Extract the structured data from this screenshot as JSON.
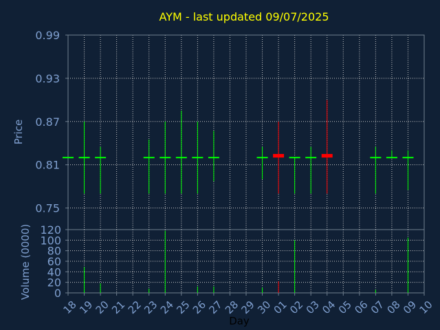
{
  "chart_data": {
    "type": "candlestick",
    "title": "AYM - last updated 09/07/2025",
    "xlabel": "Day",
    "colors": {
      "background": "#102035",
      "title": "#ffff00",
      "text": "#7f9fcf",
      "frame": "#6f7f8f",
      "grid": "#c8c8c8",
      "up": "#00ff00",
      "down": "#ff0000"
    },
    "days": [
      "18",
      "19",
      "20",
      "21",
      "22",
      "23",
      "24",
      "25",
      "26",
      "27",
      "28",
      "29",
      "30",
      "01",
      "02",
      "03",
      "04",
      "05",
      "06",
      "07",
      "08",
      "09",
      "10"
    ],
    "price_panel": {
      "ylabel": "Price",
      "ylim": [
        0.72,
        0.99
      ],
      "yticks": [
        "0.99",
        "0.93",
        "0.87",
        "0.81",
        "0.75"
      ],
      "candles": [
        {
          "day": "18",
          "open": 0.82,
          "high": 0.82,
          "low": 0.82,
          "close": 0.82,
          "dir": "up"
        },
        {
          "day": "19",
          "open": 0.82,
          "high": 0.87,
          "low": 0.77,
          "close": 0.82,
          "dir": "up"
        },
        {
          "day": "20",
          "open": 0.82,
          "high": 0.835,
          "low": 0.77,
          "close": 0.82,
          "dir": "up"
        },
        {
          "day": "23",
          "open": 0.82,
          "high": 0.845,
          "low": 0.77,
          "close": 0.82,
          "dir": "up"
        },
        {
          "day": "24",
          "open": 0.82,
          "high": 0.87,
          "low": 0.77,
          "close": 0.82,
          "dir": "up"
        },
        {
          "day": "25",
          "open": 0.82,
          "high": 0.885,
          "low": 0.77,
          "close": 0.82,
          "dir": "up"
        },
        {
          "day": "26",
          "open": 0.82,
          "high": 0.87,
          "low": 0.77,
          "close": 0.82,
          "dir": "up"
        },
        {
          "day": "27",
          "open": 0.82,
          "high": 0.857,
          "low": 0.787,
          "close": 0.82,
          "dir": "up"
        },
        {
          "day": "30",
          "open": 0.82,
          "high": 0.835,
          "low": 0.79,
          "close": 0.82,
          "dir": "up"
        },
        {
          "day": "01",
          "open": 0.825,
          "high": 0.87,
          "low": 0.77,
          "close": 0.82,
          "dir": "down"
        },
        {
          "day": "02",
          "open": 0.82,
          "high": 0.82,
          "low": 0.77,
          "close": 0.82,
          "dir": "up"
        },
        {
          "day": "03",
          "open": 0.82,
          "high": 0.835,
          "low": 0.77,
          "close": 0.82,
          "dir": "up"
        },
        {
          "day": "04",
          "open": 0.825,
          "high": 0.9,
          "low": 0.77,
          "close": 0.82,
          "dir": "down"
        },
        {
          "day": "07",
          "open": 0.82,
          "high": 0.835,
          "low": 0.77,
          "close": 0.82,
          "dir": "up"
        },
        {
          "day": "08",
          "open": 0.82,
          "high": 0.83,
          "low": 0.82,
          "close": 0.82,
          "dir": "up"
        },
        {
          "day": "09",
          "open": 0.82,
          "high": 0.83,
          "low": 0.775,
          "close": 0.82,
          "dir": "up"
        }
      ]
    },
    "volume_panel": {
      "ylabel": "Volume (0000)",
      "ylim": [
        0,
        120
      ],
      "yticks": [
        "120",
        "100",
        "80",
        "60",
        "40",
        "20",
        "0"
      ],
      "bars": [
        {
          "day": "19",
          "value": 49,
          "dir": "up"
        },
        {
          "day": "20",
          "value": 18,
          "dir": "up"
        },
        {
          "day": "23",
          "value": 8,
          "dir": "up"
        },
        {
          "day": "24",
          "value": 118,
          "dir": "up"
        },
        {
          "day": "26",
          "value": 12,
          "dir": "up"
        },
        {
          "day": "27",
          "value": 12,
          "dir": "up"
        },
        {
          "day": "30",
          "value": 10,
          "dir": "up"
        },
        {
          "day": "01",
          "value": 22,
          "dir": "down"
        },
        {
          "day": "02",
          "value": 100,
          "dir": "up"
        },
        {
          "day": "07",
          "value": 6,
          "dir": "up"
        },
        {
          "day": "09",
          "value": 105,
          "dir": "up"
        }
      ]
    },
    "grid": true
  }
}
